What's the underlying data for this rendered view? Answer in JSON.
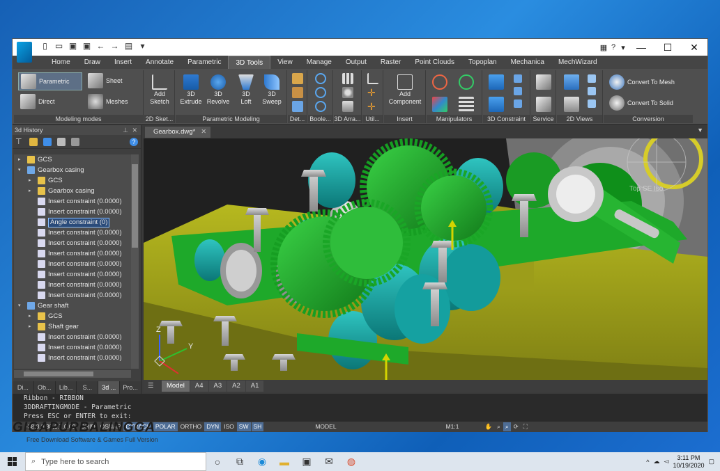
{
  "window": {
    "title": "",
    "help": "?",
    "minimize": "—",
    "maximize": "☐",
    "close": "✕"
  },
  "ribbon_tabs": [
    "Home",
    "Draw",
    "Insert",
    "Annotate",
    "Parametric",
    "3D Tools",
    "View",
    "Manage",
    "Output",
    "Raster",
    "Point Clouds",
    "Topoplan",
    "Mechanica",
    "MechWizard"
  ],
  "active_tab": "3D Tools",
  "ribbon": {
    "modeling_modes": {
      "label": "Modeling modes",
      "parametric": "Parametric",
      "direct": "Direct",
      "sheet": "Sheet",
      "meshes": "Meshes"
    },
    "sketch": {
      "label": "2D Sket...",
      "add": "Add",
      "sketch": "Sketch"
    },
    "param_modeling": {
      "label": "Parametric Modeling",
      "extrude1": "3D",
      "extrude2": "Extrude",
      "revolve1": "3D",
      "revolve2": "Revolve",
      "loft1": "3D",
      "loft2": "Loft",
      "sweep1": "3D",
      "sweep2": "Sweep"
    },
    "det": {
      "label": "Det..."
    },
    "boole": {
      "label": "Boole..."
    },
    "arr": {
      "label": "3D Arra..."
    },
    "util": {
      "label": "Util..."
    },
    "insert": {
      "label": "Insert",
      "add1": "Add",
      "add2": "Component"
    },
    "manip": {
      "label": "Manipulators"
    },
    "constraint": {
      "label": "3D Constraint"
    },
    "service": {
      "label": "Service"
    },
    "views": {
      "label": "2D Views"
    },
    "conversion": {
      "label": "Conversion",
      "mesh": "Convert To Mesh",
      "solid": "Convert To Solid"
    }
  },
  "side_panel": {
    "title": "3d History",
    "tabs": [
      "Di...",
      "Ob...",
      "Lib...",
      "S...",
      "3d ...",
      "Pro..."
    ],
    "tree": [
      {
        "label": "GCS",
        "indent": 0,
        "toggle": "▸",
        "icon": "folder-icon",
        "color": "#e8c24a"
      },
      {
        "label": "Gearbox casing",
        "indent": 0,
        "toggle": "▾",
        "icon": "part-icon",
        "color": "#6fa8e8"
      },
      {
        "label": "GCS",
        "indent": 1,
        "toggle": "▸",
        "icon": "folder-icon",
        "color": "#e8c24a"
      },
      {
        "label": "Gearbox casing",
        "indent": 1,
        "toggle": "▸",
        "icon": "folder-icon",
        "color": "#e8c24a"
      },
      {
        "label": "Insert constraint (0.0000)",
        "indent": 1,
        "toggle": "",
        "icon": "constraint-icon",
        "color": "#d9d9f0"
      },
      {
        "label": "Insert constraint (0.0000)",
        "indent": 1,
        "toggle": "",
        "icon": "constraint-icon",
        "color": "#d9d9f0"
      },
      {
        "label": "Angle constraint (0)",
        "indent": 1,
        "toggle": "",
        "icon": "angle-icon",
        "color": "#d9d9f0",
        "selected": true
      },
      {
        "label": "Insert constraint (0.0000)",
        "indent": 1,
        "toggle": "",
        "icon": "constraint-icon",
        "color": "#d9d9f0"
      },
      {
        "label": "Insert constraint (0.0000)",
        "indent": 1,
        "toggle": "",
        "icon": "constraint-icon",
        "color": "#d9d9f0"
      },
      {
        "label": "Insert constraint (0.0000)",
        "indent": 1,
        "toggle": "",
        "icon": "constraint-icon",
        "color": "#d9d9f0"
      },
      {
        "label": "Insert constraint (0.0000)",
        "indent": 1,
        "toggle": "",
        "icon": "constraint-icon",
        "color": "#d9d9f0"
      },
      {
        "label": "Insert constraint (0.0000)",
        "indent": 1,
        "toggle": "",
        "icon": "constraint-icon",
        "color": "#d9d9f0"
      },
      {
        "label": "Insert constraint (0.0000)",
        "indent": 1,
        "toggle": "",
        "icon": "constraint-icon",
        "color": "#d9d9f0"
      },
      {
        "label": "Insert constraint (0.0000)",
        "indent": 1,
        "toggle": "",
        "icon": "constraint-icon",
        "color": "#d9d9f0"
      },
      {
        "label": "Gear shaft",
        "indent": 0,
        "toggle": "▾",
        "icon": "part-icon",
        "color": "#6fa8e8"
      },
      {
        "label": "GCS",
        "indent": 1,
        "toggle": "▸",
        "icon": "folder-icon",
        "color": "#e8c24a"
      },
      {
        "label": "Shaft gear",
        "indent": 1,
        "toggle": "▸",
        "icon": "folder-icon",
        "color": "#e8c24a"
      },
      {
        "label": "Insert constraint (0.0000)",
        "indent": 1,
        "toggle": "",
        "icon": "constraint-icon",
        "color": "#d9d9f0"
      },
      {
        "label": "Insert constraint (0.0000)",
        "indent": 1,
        "toggle": "",
        "icon": "constraint-icon",
        "color": "#d9d9f0"
      },
      {
        "label": "Insert constraint (0.0000)",
        "indent": 1,
        "toggle": "",
        "icon": "constraint-icon",
        "color": "#d9d9f0"
      }
    ]
  },
  "document_tab": "Gearbox.dwg*",
  "viewcube_label": "Top SE Iso",
  "axis": {
    "x": "X",
    "y": "Y",
    "z": "Z"
  },
  "layout_tabs": [
    "Model",
    "A4",
    "A3",
    "A2",
    "A1"
  ],
  "command_lines": [
    "Ribbon - RIBBON",
    "3DDRAFTINGMODE - Parametric",
    "Press ESC or ENTER to exit:"
  ],
  "status": {
    "coords": "-38.3,3.38,1.7.0.00",
    "buttons": [
      "GRID",
      "OSNAP",
      "OTRACK",
      "POLAR",
      "ORTHO",
      "DYN",
      "ISO",
      "SW",
      "SH"
    ],
    "on": [
      "OTRACK",
      "POLAR",
      "DYN",
      "SW",
      "SH"
    ],
    "model": "MODEL",
    "scale": "M1:1"
  },
  "watermark": {
    "main": "GIGAPURBALINGGA",
    "sub": "Free Download Software & Games Full Version"
  },
  "taskbar": {
    "search_placeholder": "Type here to search",
    "time": "3:11 PM",
    "date": "10/19/2020"
  },
  "colors": {
    "accent": "#4e6d95",
    "gear_green": "#22a52b",
    "bearing_teal": "#13a3a3",
    "casing_yellow": "#a7a918"
  }
}
